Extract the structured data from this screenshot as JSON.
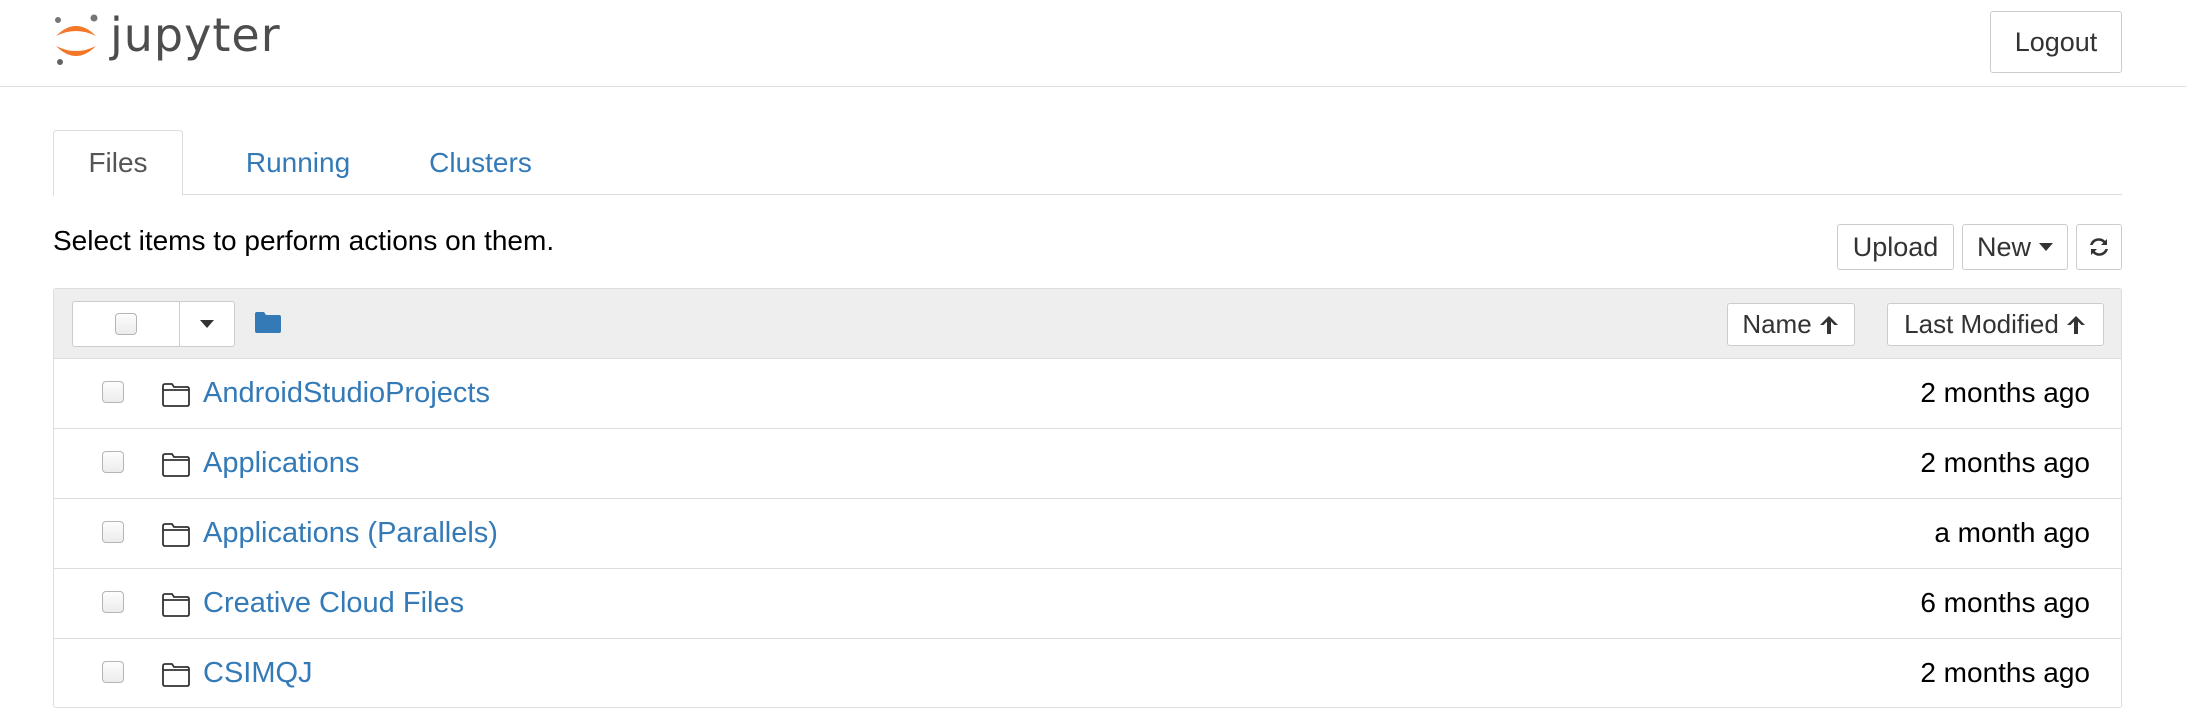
{
  "header": {
    "logo_text": "jupyter",
    "logout_label": "Logout"
  },
  "tabs": [
    {
      "label": "Files",
      "active": true
    },
    {
      "label": "Running",
      "active": false
    },
    {
      "label": "Clusters",
      "active": false
    }
  ],
  "toolbar": {
    "instructions": "Select items to perform actions on them.",
    "upload_label": "Upload",
    "new_label": "New",
    "refresh_icon": "refresh-icon"
  },
  "list_header": {
    "sort_name_label": "Name",
    "sort_modified_label": "Last Modified",
    "sort_icon": "arrow-up-icon"
  },
  "files": [
    {
      "name": "AndroidStudioProjects",
      "modified": "2 months ago",
      "type": "folder"
    },
    {
      "name": "Applications",
      "modified": "2 months ago",
      "type": "folder"
    },
    {
      "name": "Applications (Parallels)",
      "modified": "a month ago",
      "type": "folder"
    },
    {
      "name": "Creative Cloud Files",
      "modified": "6 months ago",
      "type": "folder"
    },
    {
      "name": "CSIMQJ",
      "modified": "2 months ago",
      "type": "folder"
    }
  ],
  "colors": {
    "link": "#337ab7",
    "logo_orange": "#f37726",
    "logo_text": "#4d4d4d",
    "border": "#dddddd",
    "header_bg": "#eeeeee"
  }
}
